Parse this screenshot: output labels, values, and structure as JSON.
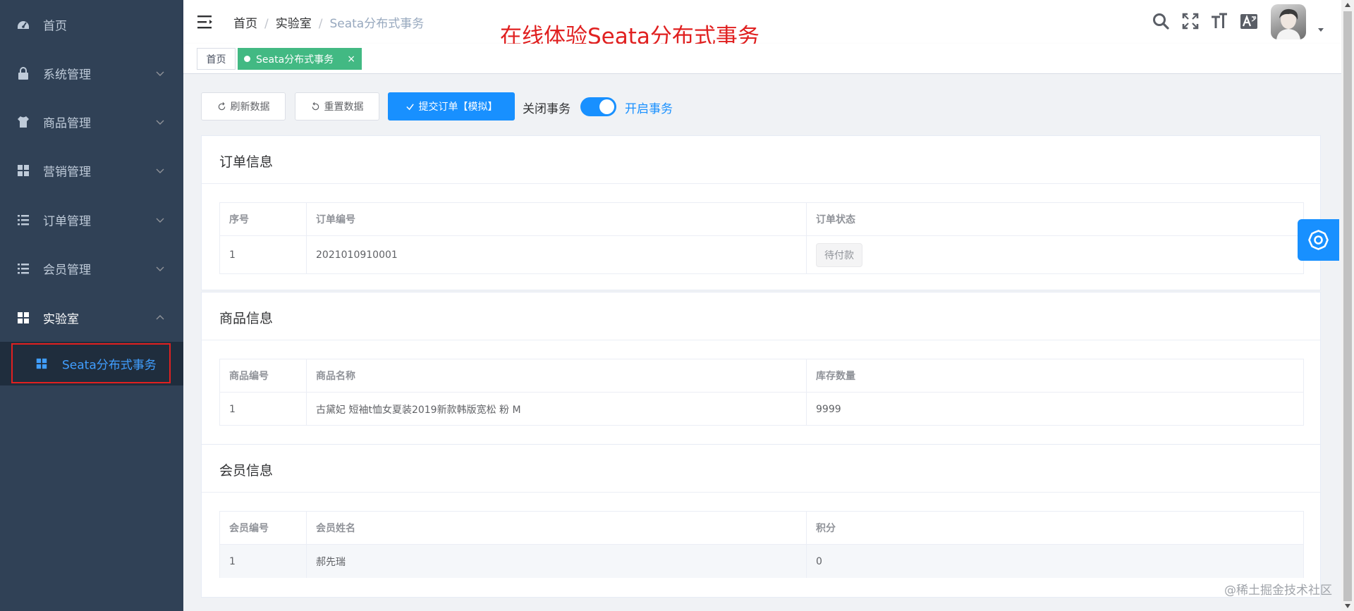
{
  "sidebar": {
    "items": [
      {
        "label": "首页",
        "icon": "dashboard-icon"
      },
      {
        "label": "系统管理",
        "icon": "lock-icon"
      },
      {
        "label": "商品管理",
        "icon": "shirt-icon"
      },
      {
        "label": "营销管理",
        "icon": "grid-icon"
      },
      {
        "label": "订单管理",
        "icon": "list-icon"
      },
      {
        "label": "会员管理",
        "icon": "list-icon"
      },
      {
        "label": "实验室",
        "icon": "grid-icon"
      }
    ],
    "submenu": {
      "label": "Seata分布式事务",
      "icon": "grid-icon"
    }
  },
  "navbar": {
    "breadcrumb": [
      "首页",
      "实验室",
      "Seata分布式事务"
    ],
    "separator": "/",
    "banner": "在线体验Seata分布式事务"
  },
  "tags": {
    "home": "首页",
    "active": "Seata分布式事务",
    "close": "×"
  },
  "toolbar": {
    "refresh": "刷新数据",
    "reset": "重置数据",
    "submit": "提交订单【模拟】",
    "switch_off": "关闭事务",
    "switch_on": "开启事务",
    "transaction_enabled": true
  },
  "order": {
    "title": "订单信息",
    "columns": [
      "序号",
      "订单编号",
      "订单状态"
    ],
    "rows": [
      {
        "id": "1",
        "no": "2021010910001",
        "status": "待付款"
      }
    ]
  },
  "product": {
    "title": "商品信息",
    "columns": [
      "商品编号",
      "商品名称",
      "库存数量"
    ],
    "rows": [
      {
        "id": "1",
        "name": "古黛妃 短袖t恤女夏装2019新款韩版宽松 粉 M",
        "stock": "9999"
      }
    ]
  },
  "member": {
    "title": "会员信息",
    "columns": [
      "会员编号",
      "会员姓名",
      "积分"
    ],
    "rows": [
      {
        "id": "1",
        "name": "郝先瑞",
        "points": "0"
      }
    ]
  },
  "watermark": "@稀土掘金技术社区",
  "colors": {
    "sidebar_bg": "#304156",
    "primary": "#1890ff",
    "tag_active": "#42b983",
    "highlight_border": "#e02020"
  }
}
